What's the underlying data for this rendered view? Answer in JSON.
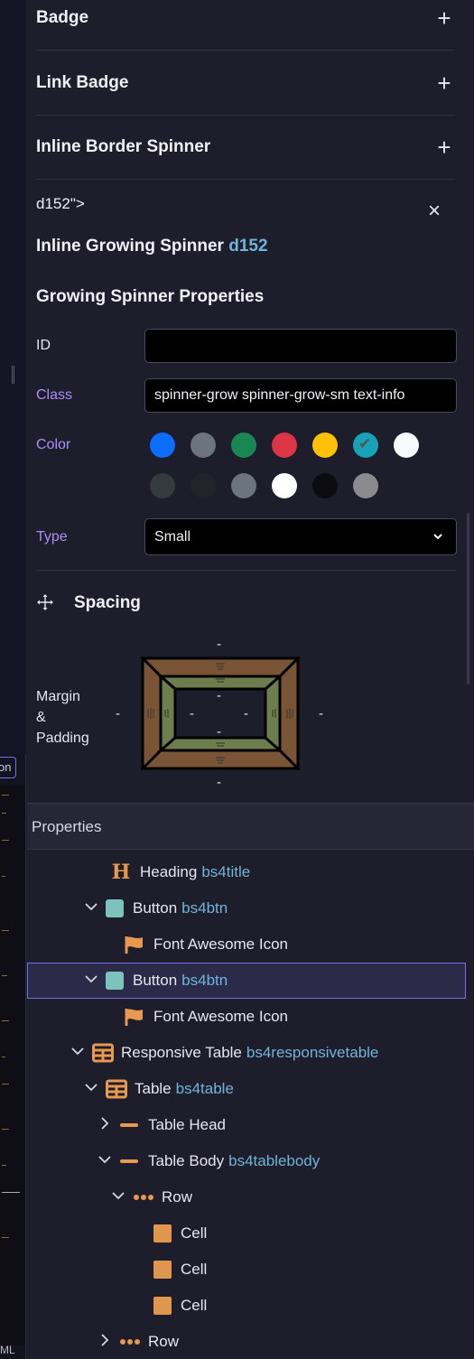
{
  "accordion": [
    {
      "title": "Badge",
      "action": "+"
    },
    {
      "title": "Link Badge",
      "action": "+"
    },
    {
      "title": "Inline Border Spinner",
      "action": "+"
    }
  ],
  "raw_text": "d152\">",
  "close_symbol": "×",
  "component": {
    "name": "Inline Growing Spinner",
    "tag": "d152"
  },
  "properties_section": {
    "heading": "Growing Spinner Properties",
    "id_label": "ID",
    "id_value": "",
    "class_label": "Class",
    "class_value": "spinner-grow spinner-grow-sm text-info",
    "color_label": "Color",
    "colors_row1": [
      "#0d6efd",
      "#6c757d",
      "#198754",
      "#dc3545",
      "#ffc107",
      "#17a2b8",
      "#f8f9fa"
    ],
    "colors_row2": [
      "#343a40",
      "#212529",
      "#6c757d",
      "#ffffff",
      "#0b0b10",
      "#8a8a8f"
    ],
    "selected_color": "#17a2b8",
    "type_label": "Type",
    "type_value": "Small"
  },
  "spacing": {
    "title": "Spacing",
    "icon": "move-arrows-icon",
    "label": "Margin & Padding",
    "margin_color": "#7a5535",
    "padding_color": "#6e7d4e",
    "values": {
      "margin_top": "-",
      "margin_left": "-",
      "margin_right": "-",
      "margin_bottom": "-",
      "padding_top": "-",
      "padding_left": "-",
      "padding_right": "-",
      "padding_bottom": "-"
    }
  },
  "tree": {
    "header": "Properties",
    "rows": [
      {
        "label": "Heading",
        "tag": "bs4title",
        "icon": "heading-icon"
      },
      {
        "label": "Button",
        "tag": "bs4btn",
        "icon": "button-icon",
        "expanded": true
      },
      {
        "label": "Font Awesome Icon",
        "tag": "",
        "icon": "flag-icon"
      },
      {
        "label": "Button",
        "tag": "bs4btn",
        "icon": "button-icon",
        "expanded": true,
        "selected": true
      },
      {
        "label": "Font Awesome Icon",
        "tag": "",
        "icon": "flag-icon"
      },
      {
        "label": "Responsive Table",
        "tag": "bs4responsivetable",
        "icon": "table-icon",
        "expanded": true
      },
      {
        "label": "Table",
        "tag": "bs4table",
        "icon": "table-icon",
        "expanded": true
      },
      {
        "label": "Table Head",
        "tag": "",
        "icon": "dash-icon",
        "expanded": false
      },
      {
        "label": "Table Body",
        "tag": "bs4tablebody",
        "icon": "dash-icon",
        "expanded": true
      },
      {
        "label": "Row",
        "tag": "",
        "icon": "dots-icon",
        "expanded": true
      },
      {
        "label": "Cell",
        "tag": "",
        "icon": "cell-icon"
      },
      {
        "label": "Cell",
        "tag": "",
        "icon": "cell-icon"
      },
      {
        "label": "Cell",
        "tag": "",
        "icon": "cell-icon"
      },
      {
        "label": "Row",
        "tag": "",
        "icon": "dots-icon",
        "expanded": false
      }
    ]
  },
  "left_strip": {
    "tab_text": "on",
    "bottom_text": "ML"
  }
}
